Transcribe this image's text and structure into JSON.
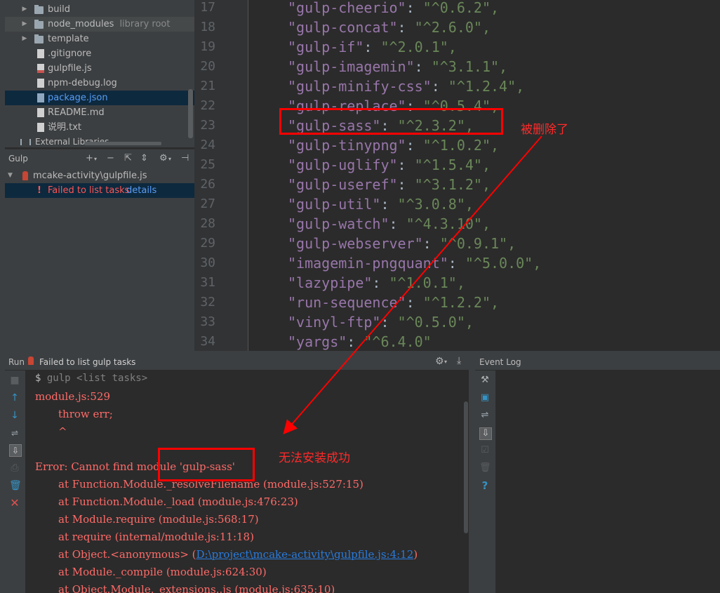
{
  "project_tree": {
    "items": [
      {
        "label": "build",
        "type": "folder",
        "expandable": true
      },
      {
        "label": "node_modules",
        "sub": "library root",
        "type": "folder",
        "expandable": true
      },
      {
        "label": "template",
        "type": "folder",
        "expandable": true
      },
      {
        "label": ".gitignore",
        "type": "file"
      },
      {
        "label": "gulpfile.js",
        "type": "js"
      },
      {
        "label": "npm-debug.log",
        "type": "file"
      },
      {
        "label": "package.json",
        "type": "json",
        "selected": true
      },
      {
        "label": "README.md",
        "type": "file"
      },
      {
        "label": "说明.txt",
        "type": "file"
      }
    ],
    "external_libraries": "External Libraries"
  },
  "gulp_panel": {
    "title": "Gulp",
    "toolbar_icons": [
      "add-icon",
      "collapse-icon",
      "sort-icon",
      "expand-icon",
      "settings-icon",
      "hide-icon"
    ],
    "gulpfile": "mcake-activity\\gulpfile.js",
    "error_text": "Failed to list tasks",
    "details_link": "details"
  },
  "editor": {
    "lines": [
      {
        "num": "17",
        "key": "\"gulp-cheerio\"",
        "value": "\"^0.6.2\","
      },
      {
        "num": "18",
        "key": "\"gulp-concat\"",
        "value": "\"^2.6.0\","
      },
      {
        "num": "19",
        "key": "\"gulp-if\"",
        "value": "\"^2.0.1\","
      },
      {
        "num": "20",
        "key": "\"gulp-imagemin\"",
        "value": "\"^3.1.1\","
      },
      {
        "num": "21",
        "key": "\"gulp-minify-css\"",
        "value": "\"^1.2.4\","
      },
      {
        "num": "22",
        "key": "\"gulp-replace\"",
        "value": "\"^0.5.4\","
      },
      {
        "num": "23",
        "key": "\"gulp-sass\"",
        "value": "\"^2.3.2\","
      },
      {
        "num": "24",
        "key": "\"gulp-tinypng\"",
        "value": "\"^1.0.2\","
      },
      {
        "num": "25",
        "key": "\"gulp-uglify\"",
        "value": "\"^1.5.4\","
      },
      {
        "num": "26",
        "key": "\"gulp-useref\"",
        "value": "\"^3.1.2\","
      },
      {
        "num": "27",
        "key": "\"gulp-util\"",
        "value": "\"^3.0.8\","
      },
      {
        "num": "28",
        "key": "\"gulp-watch\"",
        "value": "\"^4.3.10\","
      },
      {
        "num": "29",
        "key": "\"gulp-webserver\"",
        "value": "\"^0.9.1\","
      },
      {
        "num": "30",
        "key": "\"imagemin-pngquant\"",
        "value": "\"^5.0.0\","
      },
      {
        "num": "31",
        "key": "\"lazypipe\"",
        "value": "\"^1.0.1\","
      },
      {
        "num": "32",
        "key": "\"run-sequence\"",
        "value": "\"^1.2.2\","
      },
      {
        "num": "33",
        "key": "\"vinyl-ftp\"",
        "value": "\"^0.5.0\","
      },
      {
        "num": "34",
        "key": "\"yargs\"",
        "value": "\"^6.4.0\""
      }
    ]
  },
  "run_panel": {
    "label": "Run",
    "tab_title": "Failed to list gulp tasks",
    "prompt": "$",
    "command": "gulp <list tasks>",
    "console_lines": [
      {
        "text": "module.js:529",
        "indent": false
      },
      {
        "text": "throw err;",
        "indent": true
      },
      {
        "text": "^",
        "indent": true
      },
      {
        "text": "",
        "indent": false
      },
      {
        "text": "Error: Cannot find module 'gulp-sass'",
        "indent": false
      },
      {
        "text": "at Function.Module._resolveFilename (module.js:527:15)",
        "indent": true
      },
      {
        "text": "at Function.Module._load (module.js:476:23)",
        "indent": true
      },
      {
        "text": "at Module.require (module.js:568:17)",
        "indent": true
      },
      {
        "text": "at require (internal/module.js:11:18)",
        "indent": true
      },
      {
        "text": "at Object.<anonymous> (",
        "indent": true,
        "link": "D:\\project\\mcake-activity\\gulpfile.js:4:12",
        "after": ")"
      },
      {
        "text": "at Module._compile (module.js:624:30)",
        "indent": true
      },
      {
        "text": "at Object.Module._extensions..js (module.js:635:10)",
        "indent": true
      }
    ]
  },
  "event_log": {
    "title": "Event Log"
  },
  "annotations": {
    "deleted_note": "被删除了",
    "install_fail_note": "无法安装成功"
  },
  "colors": {
    "annotation_red": "#ff0000",
    "json_key": "#9876aa",
    "json_string": "#6a8759",
    "console_error": "#ff6b68",
    "link": "#287bde"
  }
}
